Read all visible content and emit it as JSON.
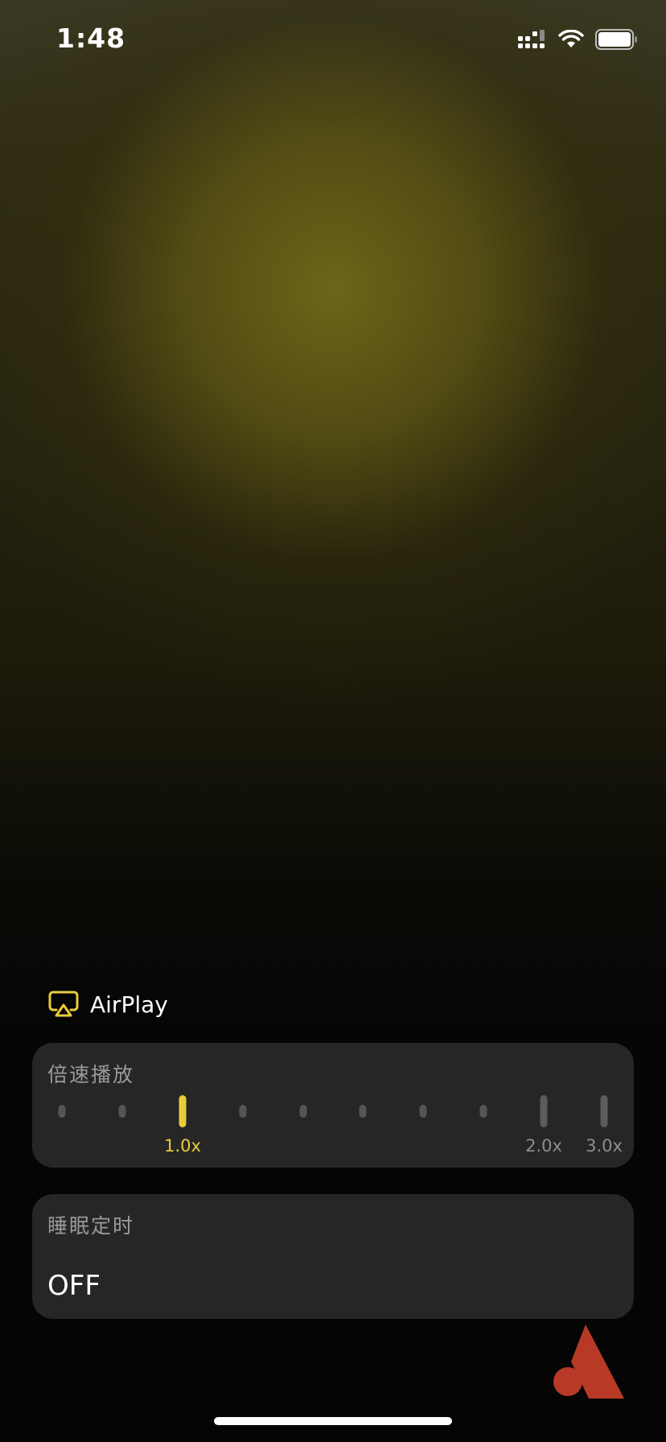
{
  "status_bar": {
    "time": "1:48",
    "signal_icon": "cellular-signal-icon",
    "wifi_icon": "wifi-icon",
    "battery_icon": "battery-icon"
  },
  "airplay": {
    "icon": "airplay-icon",
    "label": "AirPlay",
    "icon_color": "#e8cc3a"
  },
  "speed_card": {
    "title": "倍速播放",
    "selected": "1.0x",
    "accent_color": "#e8cc3a",
    "labels": {
      "one": "1.0x",
      "two": "2.0x",
      "three": "3.0x"
    }
  },
  "timer_card": {
    "title": "睡眠定时",
    "value": "OFF"
  },
  "logo": {
    "icon": "brand-logo-icon",
    "color": "#b83a26"
  }
}
